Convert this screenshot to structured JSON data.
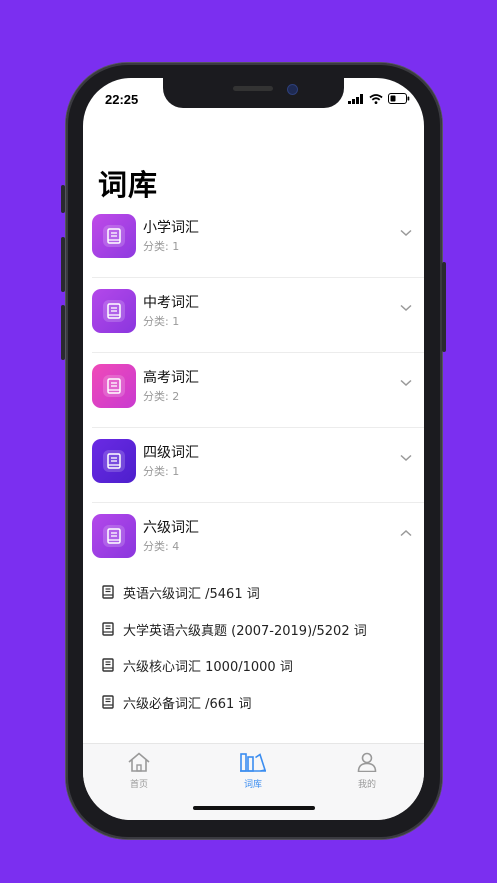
{
  "status_bar": {
    "time": "22:25"
  },
  "page": {
    "title": "词库"
  },
  "colors": {
    "accent": "#7b2ff0",
    "tab_active": "#3b8df0",
    "tab_inactive": "#999999"
  },
  "categories": [
    {
      "name": "小学词汇",
      "count_label": "分类: 1",
      "icon": "book-icon",
      "color": "#a64ae8",
      "expanded": false
    },
    {
      "name": "中考词汇",
      "count_label": "分类: 1",
      "icon": "book-icon",
      "color": "#a64ae8",
      "expanded": false
    },
    {
      "name": "高考词汇",
      "count_label": "分类: 2",
      "icon": "book-icon",
      "color": "#e04bc8",
      "expanded": false
    },
    {
      "name": "四级词汇",
      "count_label": "分类: 1",
      "icon": "book-icon",
      "color": "#5b23d8",
      "expanded": false
    },
    {
      "name": "六级词汇",
      "count_label": "分类: 4",
      "icon": "book-icon",
      "color": "#a64ae8",
      "expanded": true,
      "items": [
        {
          "label": "英语六级词汇 /5461 词"
        },
        {
          "label": "大学英语六级真题 (2007-2019)/5202 词"
        },
        {
          "label": "六级核心词汇 1000/1000 词"
        },
        {
          "label": "六级必备词汇 /661 词"
        }
      ]
    }
  ],
  "tabs": [
    {
      "label": "首页",
      "icon": "home-icon",
      "active": false
    },
    {
      "label": "词库",
      "icon": "library-icon",
      "active": true
    },
    {
      "label": "我的",
      "icon": "person-icon",
      "active": false
    }
  ]
}
